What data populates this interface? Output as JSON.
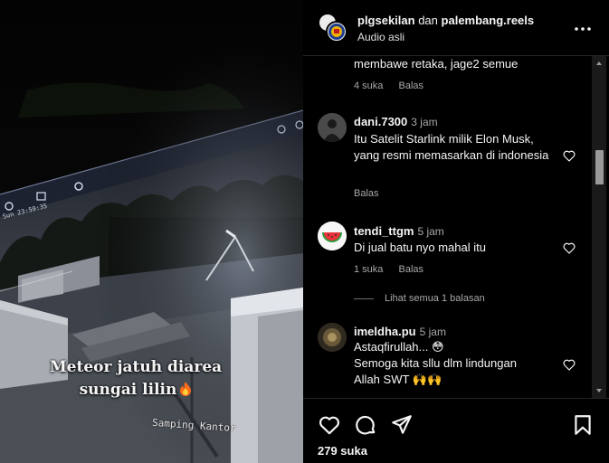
{
  "video": {
    "caption_line1": "Meteor jatuh diarea",
    "caption_line2": "sungai lilin",
    "caption_emoji": "fire-emoji",
    "watermark": "Samping Kantor",
    "timestamp": "Sun 23:59:35"
  },
  "header": {
    "user1": "plgsekilan",
    "conjunction": "dan",
    "user2": "palembang.reels",
    "audio": "Audio asli",
    "more_icon": "more-horizontal-icon"
  },
  "comments": [
    {
      "text": "membawe retaka, jage2 semue",
      "likes": "4 suka",
      "reply": "Balas"
    },
    {
      "username": "dani.7300",
      "time": "3 jam",
      "text": "Itu Satelit Starlink milik Elon Musk, yang resmi memasarkan di indonesia",
      "reply": "Balas"
    },
    {
      "username": "tendi_ttgm",
      "time": "5 jam",
      "text": "Di jual batu nyo mahal itu",
      "likes": "1 suka",
      "reply": "Balas",
      "view_replies": "Lihat semua 1 balasan"
    },
    {
      "username": "imeldha.pu",
      "time": "5 jam",
      "line1": "Astaqfirullah... 😳",
      "line2": "Semoga kita sllu dlm lindungan",
      "line3": "Allah SWT 🙌🙌"
    }
  ],
  "footer": {
    "likes": "279 suka"
  },
  "colors": {
    "background": "#000000",
    "text": "#f5f5f5",
    "secondary_text": "#a8a8a8",
    "divider": "#262626"
  }
}
